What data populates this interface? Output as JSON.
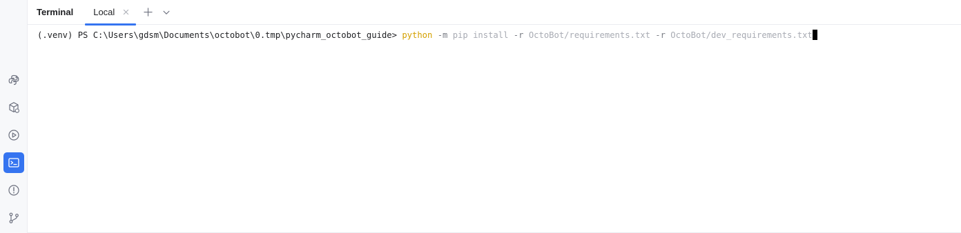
{
  "toolwindow": {
    "title": "Terminal"
  },
  "tabs": [
    {
      "label": "Local",
      "selected": true
    }
  ],
  "icons": {
    "close": "close-icon",
    "new_tab": "plus-icon",
    "dropdown": "chevron-down-icon"
  },
  "toolstrip": [
    {
      "name": "python-console-icon",
      "active": false
    },
    {
      "name": "python-packages-icon",
      "active": false
    },
    {
      "name": "services-icon",
      "active": false
    },
    {
      "name": "terminal-icon",
      "active": true
    },
    {
      "name": "problems-icon",
      "active": false
    },
    {
      "name": "git-icon",
      "active": false
    }
  ],
  "terminal": {
    "prompt": "(.venv) PS C:\\Users\\gdsm\\Documents\\octobot\\0.tmp\\pycharm_octobot_guide> ",
    "tokens": {
      "cmd": "python",
      "sp1": " ",
      "opt1": "-m",
      "sp2": " ",
      "arg1": "pip install",
      "sp3": " ",
      "opt2": "-r",
      "sp4": " ",
      "arg2": "OctoBot/requirements.txt",
      "sp5": " ",
      "opt3": "-r",
      "sp6": " ",
      "arg3": "OctoBot/dev_requirements.txt"
    }
  },
  "colors": {
    "accent": "#3574f0",
    "command": "#d4a000",
    "option": "#7a7d85",
    "argument": "#a8abb3"
  }
}
